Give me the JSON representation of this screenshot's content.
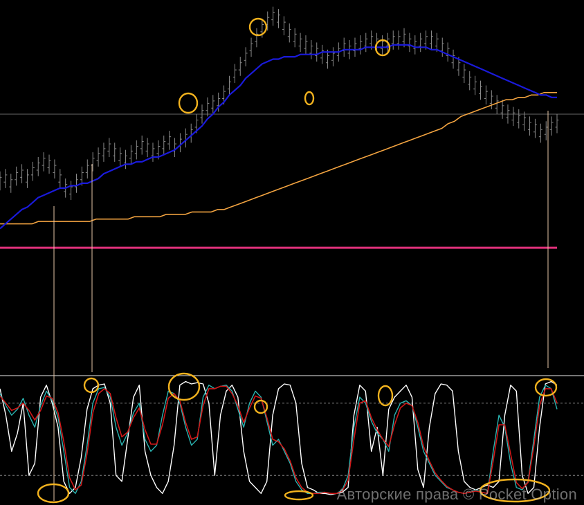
{
  "watermark": "Авторские права © Pocket Option",
  "colors": {
    "background": "#000000",
    "candles": "#8a8a8a",
    "ma_fast": "#1a1adb",
    "ma_slow": "#f2a340",
    "support_line": "#e0307a",
    "stoch_fast": "#ffffff",
    "stoch_k": "#2ab3b0",
    "stoch_d": "#d01818",
    "highlight": "#f2b21e",
    "guide_line": "#e8c8a8",
    "level_line": "#9a9a9a"
  },
  "chart_data": [
    {
      "type": "line",
      "panel": "price",
      "x_range": [
        0,
        120
      ],
      "y_range": [
        0,
        100
      ],
      "series": [
        {
          "key": "price",
          "values": [
            30,
            31,
            29,
            32,
            33,
            31,
            34,
            36,
            38,
            37,
            35,
            31,
            27,
            26,
            29,
            32,
            35,
            38,
            40,
            42,
            44,
            42,
            40,
            39,
            41,
            43,
            45,
            44,
            42,
            43,
            45,
            47,
            44,
            46,
            48,
            50,
            54,
            58,
            61,
            62,
            63,
            66,
            70,
            75,
            78,
            82,
            86,
            90,
            94,
            97,
            99,
            98,
            95,
            92,
            90,
            88,
            87,
            85,
            84,
            83,
            81,
            82,
            84,
            86,
            85,
            86,
            87,
            88,
            89,
            88,
            87,
            88,
            89,
            89,
            90,
            88,
            87,
            88,
            89,
            89,
            88,
            86,
            84,
            81,
            78,
            75,
            72,
            70,
            68,
            66,
            64,
            62,
            60,
            58,
            57,
            56,
            55,
            53,
            52,
            50,
            51,
            53,
            54
          ]
        },
        {
          "key": "ma_fast",
          "values": [
            10,
            12,
            14,
            16,
            18,
            19,
            21,
            23,
            24,
            25,
            26,
            27,
            27,
            28,
            28,
            29,
            29,
            30,
            31,
            33,
            34,
            35,
            36,
            37,
            37,
            38,
            38,
            39,
            40,
            40,
            41,
            42,
            43,
            45,
            47,
            49,
            51,
            53,
            56,
            58,
            61,
            63,
            66,
            68,
            70,
            73,
            75,
            77,
            79,
            80,
            81,
            81,
            82,
            82,
            82,
            83,
            83,
            83,
            83,
            84,
            84,
            84,
            84,
            85,
            85,
            85,
            85,
            86,
            86,
            86,
            86,
            86,
            87,
            87,
            87,
            87,
            86,
            86,
            86,
            85,
            85,
            84,
            83,
            82,
            81,
            80,
            79,
            78,
            77,
            76,
            75,
            74,
            73,
            72,
            71,
            70,
            69,
            68,
            67,
            66,
            66,
            65,
            65
          ]
        },
        {
          "key": "ma_slow",
          "values": [
            12,
            12,
            12,
            12,
            12,
            12,
            13,
            13,
            13,
            13,
            13,
            13,
            13,
            13,
            13,
            14,
            14,
            14,
            14,
            14,
            14,
            15,
            15,
            15,
            15,
            15,
            16,
            16,
            16,
            16,
            17,
            17,
            17,
            17,
            18,
            18,
            19,
            20,
            21,
            22,
            23,
            24,
            25,
            26,
            27,
            28,
            29,
            30,
            31,
            32,
            33,
            34,
            35,
            36,
            37,
            38,
            39,
            40,
            41,
            42,
            43,
            44,
            45,
            46,
            47,
            48,
            49,
            50,
            51,
            52,
            54,
            55,
            57,
            58,
            59,
            60,
            61,
            62,
            63,
            64,
            64,
            65,
            65,
            66,
            66,
            67,
            67,
            67
          ]
        }
      ],
      "support_level": 2
    },
    {
      "type": "line",
      "panel": "stochastic",
      "x_range": [
        0,
        120
      ],
      "y_range": [
        0,
        100
      ],
      "levels": [
        80,
        20
      ],
      "series": [
        {
          "key": "fast",
          "values": [
            92,
            70,
            40,
            55,
            80,
            20,
            30,
            85,
            95,
            80,
            60,
            15,
            5,
            10,
            35,
            75,
            92,
            95,
            96,
            80,
            20,
            15,
            50,
            85,
            95,
            40,
            20,
            10,
            5,
            15,
            45,
            95,
            98,
            96,
            97,
            96,
            80,
            20,
            70,
            90,
            95,
            85,
            40,
            15,
            10,
            5,
            15,
            70,
            92,
            96,
            95,
            80,
            30,
            10,
            8,
            5,
            5,
            4,
            5,
            6,
            10,
            70,
            95,
            90,
            40,
            60,
            20,
            75,
            85,
            90,
            95,
            85,
            25,
            10,
            60,
            88,
            96,
            95,
            90,
            40,
            15,
            10,
            8,
            10,
            12,
            10,
            15,
            70,
            95,
            90,
            20,
            5,
            10,
            60,
            96,
            98,
            95
          ]
        },
        {
          "key": "k",
          "values": [
            88,
            78,
            70,
            75,
            84,
            70,
            60,
            78,
            90,
            82,
            68,
            40,
            10,
            5,
            15,
            45,
            80,
            92,
            93,
            85,
            60,
            45,
            55,
            72,
            80,
            50,
            40,
            45,
            70,
            90,
            88,
            80,
            60,
            45,
            50,
            85,
            95,
            92,
            94,
            95,
            90,
            75,
            60,
            80,
            90,
            85,
            65,
            45,
            50,
            40,
            30,
            15,
            8,
            5,
            5,
            6,
            6,
            5,
            5,
            8,
            20,
            60,
            85,
            80,
            65,
            55,
            50,
            40,
            70,
            80,
            82,
            78,
            60,
            40,
            30,
            20,
            15,
            10,
            8,
            6,
            5,
            6,
            8,
            6,
            5,
            40,
            70,
            60,
            30,
            10,
            8,
            15,
            50,
            85,
            95,
            92,
            75
          ]
        },
        {
          "key": "d",
          "values": [
            86,
            80,
            74,
            76,
            80,
            74,
            66,
            74,
            86,
            84,
            72,
            48,
            18,
            8,
            12,
            38,
            72,
            88,
            92,
            88,
            68,
            52,
            56,
            68,
            76,
            58,
            46,
            46,
            62,
            84,
            88,
            82,
            64,
            50,
            52,
            78,
            92,
            92,
            94,
            94,
            88,
            78,
            64,
            76,
            86,
            84,
            68,
            50,
            48,
            42,
            32,
            18,
            10,
            6,
            5,
            5,
            6,
            5,
            5,
            7,
            16,
            50,
            80,
            82,
            68,
            58,
            50,
            44,
            62,
            76,
            80,
            78,
            64,
            44,
            32,
            22,
            16,
            11,
            8,
            6,
            5,
            6,
            7,
            6,
            5,
            32,
            62,
            62,
            38,
            14,
            9,
            14,
            44,
            78,
            92,
            92,
            80
          ]
        }
      ]
    }
  ]
}
